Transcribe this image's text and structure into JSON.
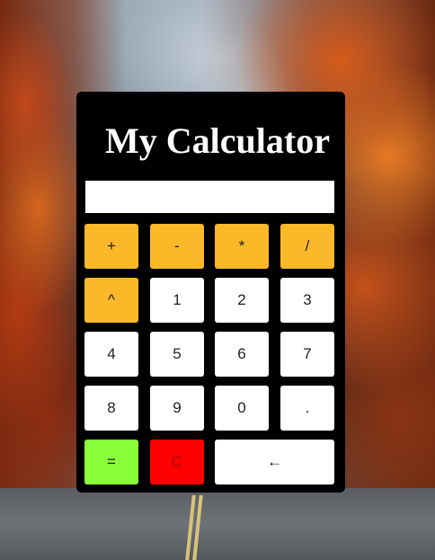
{
  "calculator": {
    "title": "My Calculator",
    "display_value": "",
    "buttons": {
      "add": "+",
      "subtract": "-",
      "multiply": "*",
      "divide": "/",
      "power": "^",
      "one": "1",
      "two": "2",
      "three": "3",
      "four": "4",
      "five": "5",
      "six": "6",
      "seven": "7",
      "eight": "8",
      "nine": "9",
      "zero": "0",
      "decimal": ".",
      "equals": "=",
      "clear": "C",
      "backspace": "←"
    }
  },
  "colors": {
    "panel": "#000000",
    "operator": "#fbb829",
    "number": "#ffffff",
    "equals": "#88ff3a",
    "clear": "#ff0000"
  }
}
